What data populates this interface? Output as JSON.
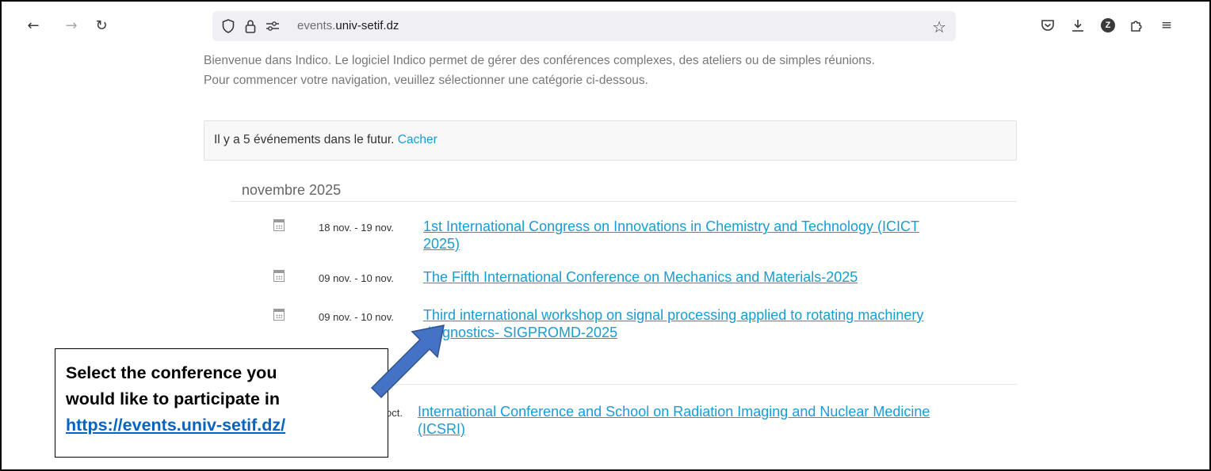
{
  "browser": {
    "url_prefix": "events.",
    "url_domain": "univ-setif.dz",
    "icons": {
      "back": "arrow-left-icon",
      "forward": "arrow-right-icon",
      "reload": "reload-icon",
      "tracking": "shield-icon",
      "lock": "lock-icon",
      "permissions": "site-permissions-icon",
      "bookmark": "star-icon",
      "pocket": "pocket-icon",
      "downloads": "download-icon",
      "account": "account-avatar-icon",
      "extensions": "extensions-icon",
      "menu": "hamburger-menu-icon"
    },
    "account_letter": "Z"
  },
  "page": {
    "intro_line1": "Bienvenue dans Indico. Le logiciel Indico permet de gérer des conférences complexes, des ateliers ou de simples réunions.",
    "intro_line2": "Pour commencer votre navigation, veuillez sélectionner une catégorie ci-dessous.",
    "notice_text": "Il y a 5 événements dans le futur. ",
    "notice_link": "Cacher",
    "month": "novembre 2025",
    "events": [
      {
        "date": "18 nov. - 19 nov.",
        "title_line1": "1st International Congress on Innovations in Chemistry and Technology (ICICT",
        "title_line2": "2025)"
      },
      {
        "date": "09 nov. - 10 nov.",
        "title_line1": "The Fifth International Conference on Mechanics and Materials-2025",
        "title_line2": ""
      },
      {
        "date": "09 nov. - 10 nov.",
        "title_line1": "Third international workshop on signal processing applied to rotating machinery",
        "title_line2": "diagnostics- SIGPROMD-2025"
      },
      {
        "date": "oct.",
        "title_line1": "International Conference and School on Radiation Imaging and Nuclear Medicine",
        "title_line2": "(ICSRI)"
      }
    ]
  },
  "annotation": {
    "line1": "Select the conference you",
    "line2": "would like to participate in",
    "link": "https://events.univ-setif.dz/",
    "arrow_color": "#4472c4"
  },
  "colors": {
    "link": "#1a9bd4",
    "annotation_link": "#0563c1"
  }
}
